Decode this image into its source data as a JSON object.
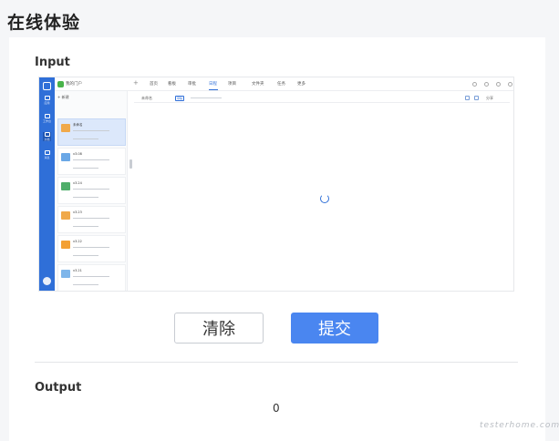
{
  "page": {
    "title": "在线体验"
  },
  "input": {
    "label": "Input"
  },
  "screenshot": {
    "app_name": "我的门户",
    "nav": [
      "应用",
      "工作台",
      "文档",
      "消息"
    ],
    "tabs": [
      "首页",
      "看板",
      "审批",
      "日程",
      "项目",
      "文件夹",
      "任务",
      "更多"
    ],
    "active_tab_index": 3,
    "list_header": "+ 新建",
    "items": [
      {
        "title": "未命名",
        "thumb_color": "#f0a94a"
      },
      {
        "title": "v3.08",
        "thumb_color": "#6aa7e6"
      },
      {
        "title": "v3.24",
        "thumb_color": "#4fae6a"
      },
      {
        "title": "v3.23",
        "thumb_color": "#f0a94a"
      },
      {
        "title": "v3.22",
        "thumb_color": "#f3a034"
      },
      {
        "title": "v3.21",
        "thumb_color": "#7fb6ea"
      }
    ],
    "detail_title": "未命名",
    "detail_badge": "草稿",
    "detail_action": "分享"
  },
  "buttons": {
    "clear_label": "清除",
    "submit_label": "提交"
  },
  "output": {
    "label": "Output",
    "value": "0"
  },
  "watermark": "testerhome.com",
  "colors": {
    "accent": "#4a86f0",
    "sidebar": "#2f6fd8"
  }
}
